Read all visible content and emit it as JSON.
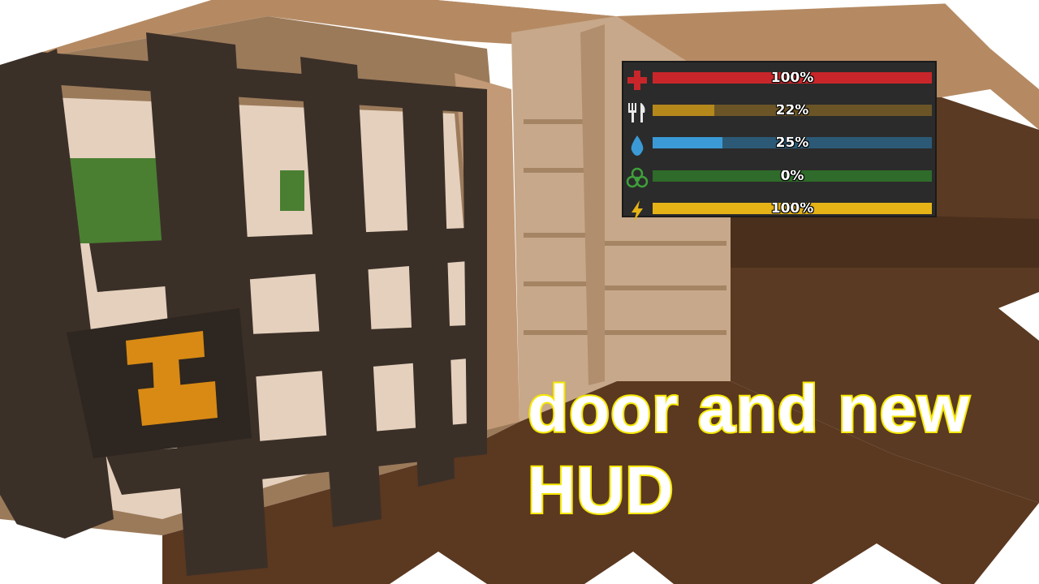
{
  "scene": {
    "description_icons": [
      "door-emblem-icon"
    ]
  },
  "hud": {
    "stats": [
      {
        "name": "health",
        "icon": "health-cross-icon",
        "value": 100,
        "label": "100%",
        "fill_color": "#c8262a",
        "track_color": "#6e1f1f"
      },
      {
        "name": "food",
        "icon": "fork-knife-icon",
        "value": 22,
        "label": "22%",
        "fill_color": "#b5881c",
        "track_color": "#6b5527"
      },
      {
        "name": "water",
        "icon": "water-drop-icon",
        "value": 25,
        "label": "25%",
        "fill_color": "#3b9ad6",
        "track_color": "#2c5a76"
      },
      {
        "name": "virus",
        "icon": "biohazard-icon",
        "value": 0,
        "label": "0%",
        "fill_color": "#3fa03a",
        "track_color": "#2f6b2a"
      },
      {
        "name": "stamina",
        "icon": "lightning-icon",
        "value": 100,
        "label": "100%",
        "fill_color": "#e6b317",
        "track_color": "#7a6317"
      }
    ]
  },
  "caption": {
    "line1": "door and new",
    "line2": "HUD"
  }
}
